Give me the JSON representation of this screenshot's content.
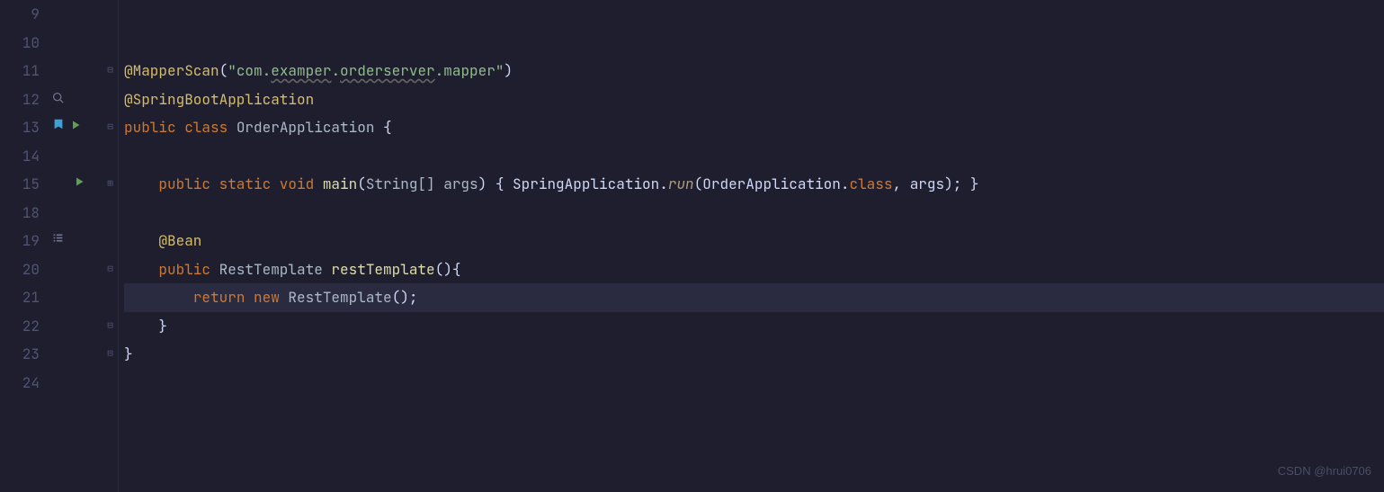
{
  "watermark": "CSDN @hrui0706",
  "lines": {
    "9": {
      "num": "9",
      "icons": [],
      "fold": "",
      "tokens": []
    },
    "10": {
      "num": "10",
      "icons": [],
      "fold": "",
      "tokens": []
    },
    "11": {
      "num": "11",
      "icons": [],
      "fold": "⊟",
      "tokens": [
        {
          "cls": "k-annotation",
          "txt": "@MapperScan"
        },
        {
          "cls": "k-punc",
          "txt": "("
        },
        {
          "cls": "k-string",
          "txt": "\"com."
        },
        {
          "cls": "k-string wavy",
          "txt": "examper"
        },
        {
          "cls": "k-string",
          "txt": "."
        },
        {
          "cls": "k-string wavy",
          "txt": "orderserver"
        },
        {
          "cls": "k-string",
          "txt": ".mapper\""
        },
        {
          "cls": "k-punc",
          "txt": ")"
        }
      ]
    },
    "12": {
      "num": "12",
      "icons": [
        "search"
      ],
      "fold": "",
      "tokens": [
        {
          "cls": "k-annotation",
          "txt": "@SpringBootApplication"
        }
      ]
    },
    "13": {
      "num": "13",
      "icons": [
        "bookmark",
        "play"
      ],
      "fold": "⊟",
      "tokens": [
        {
          "cls": "k-keyword",
          "txt": "public class "
        },
        {
          "cls": "k-class",
          "txt": "OrderApplication "
        },
        {
          "cls": "k-bracket",
          "txt": "{"
        }
      ]
    },
    "14": {
      "num": "14",
      "icons": [],
      "fold": "",
      "tokens": []
    },
    "15": {
      "num": "15",
      "icons": [
        "play"
      ],
      "fold": "⊞",
      "tokens": [
        {
          "cls": "k-white",
          "txt": "    "
        },
        {
          "cls": "k-keyword",
          "txt": "public static void "
        },
        {
          "cls": "k-method",
          "txt": "main"
        },
        {
          "cls": "k-punc",
          "txt": "("
        },
        {
          "cls": "k-type",
          "txt": "String[] "
        },
        {
          "cls": "k-param",
          "txt": "args"
        },
        {
          "cls": "k-punc",
          "txt": ") "
        },
        {
          "cls": "k-bracket",
          "txt": "{ "
        },
        {
          "cls": "k-white",
          "txt": "SpringApplication."
        },
        {
          "cls": "k-italic",
          "txt": "run"
        },
        {
          "cls": "k-punc",
          "txt": "(OrderApplication."
        },
        {
          "cls": "k-keyword",
          "txt": "class"
        },
        {
          "cls": "k-punc",
          "txt": ", args); "
        },
        {
          "cls": "k-bracket",
          "txt": "}"
        }
      ]
    },
    "18": {
      "num": "18",
      "icons": [],
      "fold": "",
      "tokens": []
    },
    "19": {
      "num": "19",
      "icons": [
        "list"
      ],
      "fold": "",
      "tokens": [
        {
          "cls": "k-white",
          "txt": "    "
        },
        {
          "cls": "k-annotation",
          "txt": "@Bean"
        }
      ]
    },
    "20": {
      "num": "20",
      "icons": [],
      "fold": "⊟",
      "tokens": [
        {
          "cls": "k-white",
          "txt": "    "
        },
        {
          "cls": "k-keyword",
          "txt": "public "
        },
        {
          "cls": "k-type",
          "txt": "RestTemplate "
        },
        {
          "cls": "k-method",
          "txt": "restTemplate"
        },
        {
          "cls": "k-punc",
          "txt": "(){"
        }
      ]
    },
    "21": {
      "num": "21",
      "icons": [],
      "fold": "",
      "hl": true,
      "tokens": [
        {
          "cls": "k-white",
          "txt": "        "
        },
        {
          "cls": "k-keyword",
          "txt": "return new "
        },
        {
          "cls": "k-type",
          "txt": "RestTemplate"
        },
        {
          "cls": "k-punc",
          "txt": "();"
        }
      ]
    },
    "22": {
      "num": "22",
      "icons": [],
      "fold": "⊟",
      "tokens": [
        {
          "cls": "k-white",
          "txt": "    "
        },
        {
          "cls": "k-bracket",
          "txt": "}"
        }
      ]
    },
    "23": {
      "num": "23",
      "icons": [],
      "fold": "⊟",
      "tokens": [
        {
          "cls": "k-bracket",
          "txt": "}"
        }
      ]
    },
    "24": {
      "num": "24",
      "icons": [],
      "fold": "",
      "tokens": []
    }
  },
  "lineOrder": [
    "9",
    "10",
    "11",
    "12",
    "13",
    "14",
    "15",
    "18",
    "19",
    "20",
    "21",
    "22",
    "23",
    "24"
  ]
}
